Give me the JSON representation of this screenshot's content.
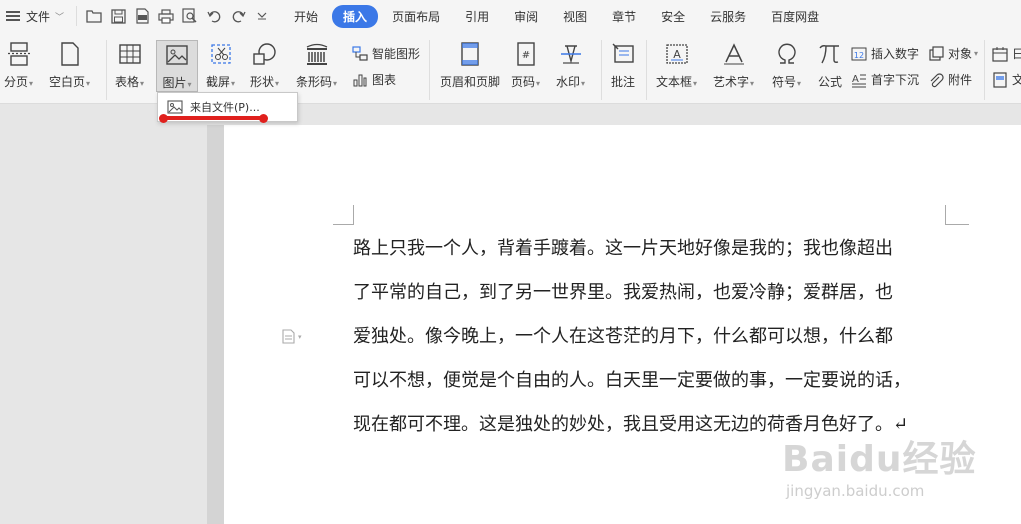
{
  "menubar": {
    "file_label": "文件",
    "tabs": [
      "开始",
      "插入",
      "页面布局",
      "引用",
      "审阅",
      "视图",
      "章节",
      "安全",
      "云服务",
      "百度网盘"
    ],
    "active_tab": "插入"
  },
  "ribbon": {
    "page_break": "分页",
    "blank_page": "空白页",
    "table": "表格",
    "picture": "图片",
    "screenshot": "截屏",
    "shapes": "形状",
    "barcode": "条形码",
    "smart_art": "智能图形",
    "chart": "图表",
    "header_footer": "页眉和页脚",
    "page_number": "页码",
    "watermark": "水印",
    "comment": "批注",
    "text_box": "文本框",
    "word_art": "艺术字",
    "symbol": "符号",
    "formula": "公式",
    "insert_number": "插入数字",
    "object": "对象",
    "drop_cap": "首字下沉",
    "attachment": "附件",
    "date_partial": "日",
    "text_partial": "文"
  },
  "dropdown": {
    "from_file": "来自文件(P)..."
  },
  "document": {
    "lines": [
      "路上只我一个人，背着手踱着。这一片天地好像是我的；我也像超出",
      "了平常的自己，到了另一世界里。我爱热闹，也爱冷静；爱群居，也",
      "爱独处。像今晚上，一个人在这苍茫的月下，什么都可以想，什么都",
      "可以不想，便觉是个自由的人。白天里一定要做的事，一定要说的话，",
      "现在都可不理。这是独处的妙处，我且受用这无边的荷香月色好了。↵"
    ]
  },
  "watermark": {
    "logo": "Baidu经验",
    "url": "jingyan.baidu.com"
  },
  "colors": {
    "accent": "#3b78e7",
    "highlight_red": "#e0201d"
  }
}
